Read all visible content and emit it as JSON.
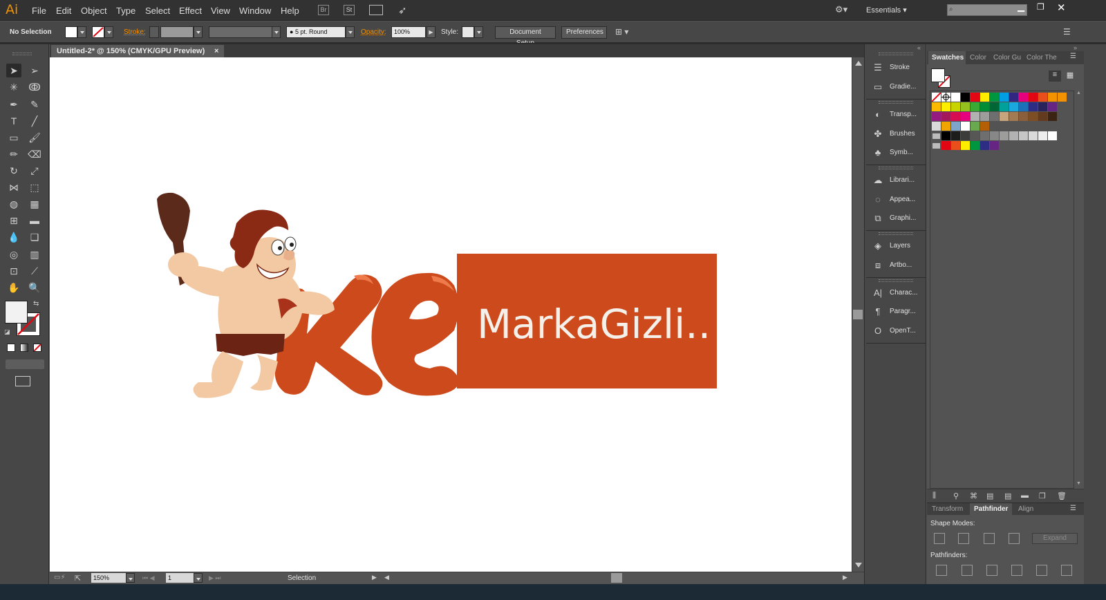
{
  "menubar": {
    "logo": "Ai",
    "menus": [
      "File",
      "Edit",
      "Object",
      "Type",
      "Select",
      "Effect",
      "View",
      "Window",
      "Help"
    ],
    "br_label": "Br",
    "st_label": "St",
    "workspace": "Essentials"
  },
  "controlbar": {
    "selection": "No Selection",
    "stroke_label": "Stroke:",
    "brush": "5 pt. Round",
    "opacity_label": "Opacity:",
    "opacity_value": "100%",
    "style_label": "Style:",
    "document_setup": "Document Setup",
    "preferences": "Preferences"
  },
  "document": {
    "tab_title": "Untitled-2* @ 150% (CMYK/GPU Preview)",
    "close": "×"
  },
  "artwork": {
    "brand_text": "MarkaGizli..",
    "brand_color": "#cd4a1c"
  },
  "statusbar": {
    "zoom": "150%",
    "artboard": "1",
    "tool": "Selection"
  },
  "dock": {
    "items": [
      "Stroke",
      "Gradie...",
      "Transp...",
      "Brushes",
      "Symb...",
      "Librari...",
      "Appea...",
      "Graphi...",
      "Layers",
      "Artbo...",
      "Charac...",
      "Paragr...",
      "OpenT..."
    ]
  },
  "swatches": {
    "tabs": [
      "Swatches",
      "Color",
      "Color Gu",
      "Color The"
    ],
    "rows": [
      [
        "none",
        "reg",
        "#ffffff",
        "#000000",
        "#e30613",
        "#ffed00",
        "#009640",
        "#009fe3",
        "#312783",
        "#e6007e",
        "#e30613",
        "#e94e1b",
        "#f39200",
        "#f39200"
      ],
      [
        "#fbb900",
        "#ffed00",
        "#c8d400",
        "#95c11f",
        "#3aaa35",
        "#008d36",
        "#006633",
        "#00a19a",
        "#1aa6df",
        "#1d71b8",
        "#2d2e83",
        "#29235c",
        "#662483"
      ],
      [
        "#951b81",
        "#a3195b",
        "#d60b52",
        "#e6007e",
        "#b2b2b2",
        "#9d9d9c",
        "#706f6f",
        "#c6a47e",
        "#a37b52",
        "#8b5e3c",
        "#7d4e24",
        "#623b1e",
        "#3c2415"
      ],
      [
        "#dadada",
        "#f0a500",
        "#7fa4c9",
        "#ffffff",
        "#6aa84f",
        "#b45f06"
      ],
      [
        "folder",
        "#000000",
        "#1d1d1b",
        "#3c3c3b",
        "#575756",
        "#706f6f",
        "#878787",
        "#9d9d9c",
        "#b2b2b2",
        "#c6c6c6",
        "#dadada",
        "#ededed",
        "#ffffff"
      ],
      [
        "folder",
        "#e30613",
        "#e94e1b",
        "#ffed00",
        "#009640",
        "#2d2e83",
        "#662483"
      ]
    ]
  },
  "bottompanel": {
    "tabs": [
      "Transform",
      "Pathfinder",
      "Align"
    ],
    "shape_modes": "Shape Modes:",
    "expand": "Expand",
    "pathfinders": "Pathfinders:"
  }
}
